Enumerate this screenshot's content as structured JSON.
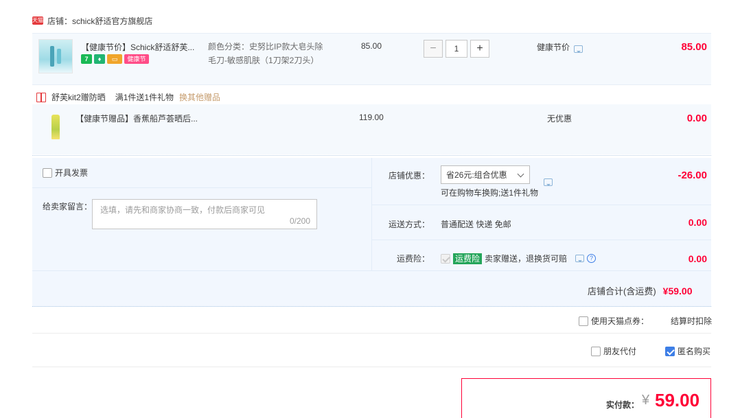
{
  "shop": {
    "badge": "天猫",
    "label": "店铺：schick舒适官方旗舰店"
  },
  "items": [
    {
      "title": "【健康节价】Schick舒适舒芙...",
      "sku_line1": "颜色分类：史努比IP款大皂头除",
      "sku_line2": "毛刀-敏感肌肤（1刀架2刀头）",
      "unit_price": "85.00",
      "quantity": "1",
      "promo": "健康节价",
      "subtotal": "85.00",
      "tags": [
        "7",
        "",
        "",
        "健康节"
      ]
    },
    {
      "title": "【健康节赠品】香蕉船芦荟晒后...",
      "unit_price": "119.00",
      "promo": "无优惠",
      "subtotal": "0.00"
    }
  ],
  "gift": {
    "name": "舒芙kit2赠防晒",
    "rule": "满1件送1件礼物",
    "change_link": "换其他赠品"
  },
  "invoice": {
    "label": "开具发票"
  },
  "message": {
    "label": "给卖家留言：",
    "placeholder": "选填，请先和商家协商一致，付款后商家可见",
    "count": "0/200"
  },
  "discount": {
    "label": "店铺优惠：",
    "selected": "省26元:组合优惠",
    "note": "可在购物车换购;送1件礼物",
    "amount": "-26.00"
  },
  "shipping": {
    "label": "运送方式：",
    "value": "普通配送 快递 免邮",
    "amount": "0.00"
  },
  "insurance": {
    "label": "运费险：",
    "tag": "运费险",
    "text": "卖家赠送，退换货可赔",
    "help": "?",
    "amount": "0.00"
  },
  "store_total": {
    "label": "店铺合计(含运费)",
    "amount": "¥59.00"
  },
  "points": {
    "label": "使用天猫点券：",
    "note": "结算时扣除"
  },
  "options": {
    "friend_pay": "朋友代付",
    "anonymous": "匿名购买"
  },
  "payment": {
    "label": "实付款：",
    "currency": "¥",
    "amount": "59.00"
  }
}
